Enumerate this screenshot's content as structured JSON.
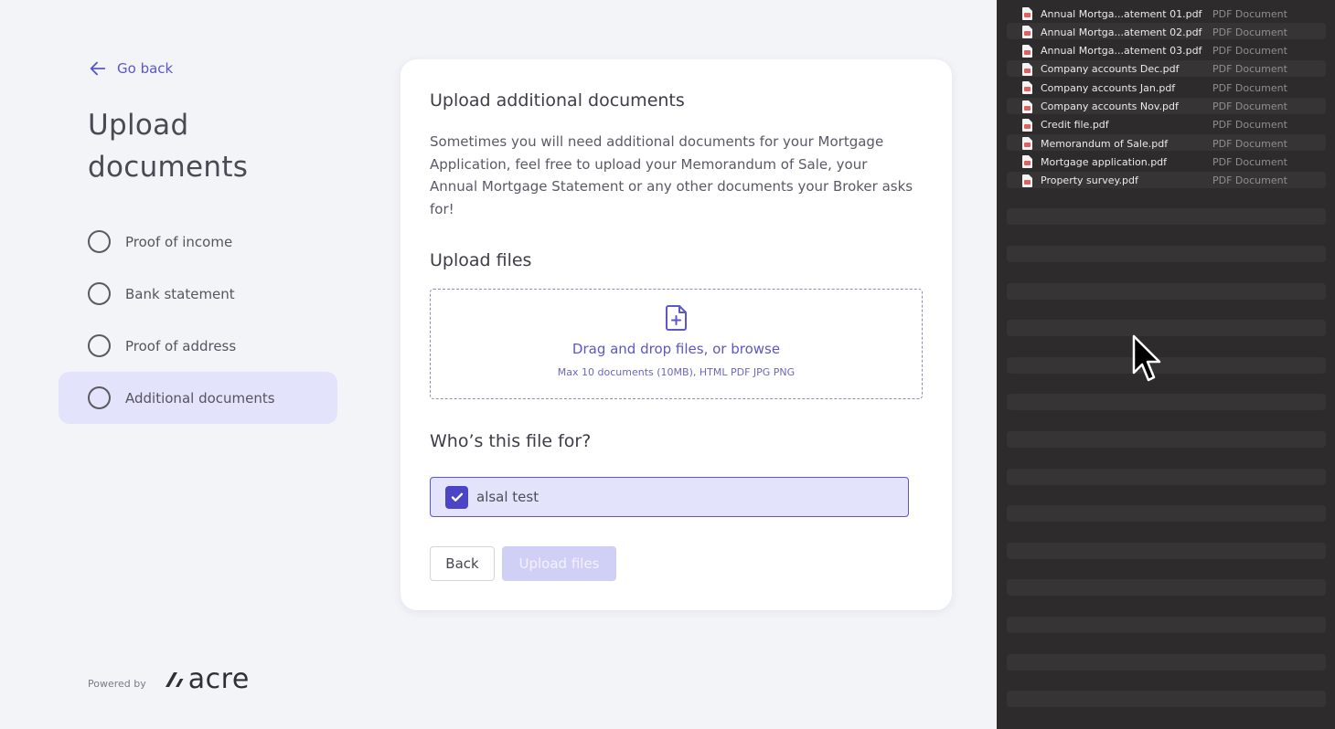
{
  "nav": {
    "go_back": "Go back"
  },
  "page_title": "Upload documents",
  "steps": [
    {
      "label": "Proof of income",
      "active": false
    },
    {
      "label": "Bank statement",
      "active": false
    },
    {
      "label": "Proof of address",
      "active": false
    },
    {
      "label": "Additional documents",
      "active": true
    }
  ],
  "card": {
    "title": "Upload additional documents",
    "description": "Sometimes you will need additional documents for your Mortgage Application, feel free to upload your Memorandum of Sale, your Annual Mortgage Statement or any other documents your Broker asks for!",
    "upload_heading": "Upload files",
    "dropzone_text": "Drag and drop files, or browse",
    "dropzone_subtext": "Max 10 documents (10MB), HTML PDF JPG PNG",
    "who_heading": "Who’s this file for?",
    "person": {
      "name": "alsal test",
      "checked": true
    },
    "back_button": "Back",
    "upload_button": "Upload files"
  },
  "footer": {
    "powered_by": "Powered by",
    "brand": "acre"
  },
  "finder": {
    "files": [
      {
        "name": "Annual Mortga...atement 01.pdf",
        "kind": "PDF Document"
      },
      {
        "name": "Annual Mortga...atement 02.pdf",
        "kind": "PDF Document"
      },
      {
        "name": "Annual Mortga...atement 03.pdf",
        "kind": "PDF Document"
      },
      {
        "name": "Company accounts Dec.pdf",
        "kind": "PDF Document"
      },
      {
        "name": "Company accounts Jan.pdf",
        "kind": "PDF Document"
      },
      {
        "name": "Company accounts Nov.pdf",
        "kind": "PDF Document"
      },
      {
        "name": "Credit file.pdf",
        "kind": "PDF Document"
      },
      {
        "name": "Memorandum of Sale.pdf",
        "kind": "PDF Document"
      },
      {
        "name": "Mortgage application.pdf",
        "kind": "PDF Document"
      },
      {
        "name": "Property survey.pdf",
        "kind": "PDF Document"
      }
    ]
  },
  "colors": {
    "accent": "#5c57c7",
    "checkbox": "#4b44c4",
    "active_step_bg": "#e3e3fb",
    "finder_bg": "#2d2b2b",
    "pdf_icon": "#e06060"
  },
  "icons": {
    "back": "arrow-left-icon",
    "upload": "file-plus-icon",
    "check": "checkmark-icon",
    "file": "pdf-file-icon",
    "cursor": "mouse-pointer-icon"
  }
}
